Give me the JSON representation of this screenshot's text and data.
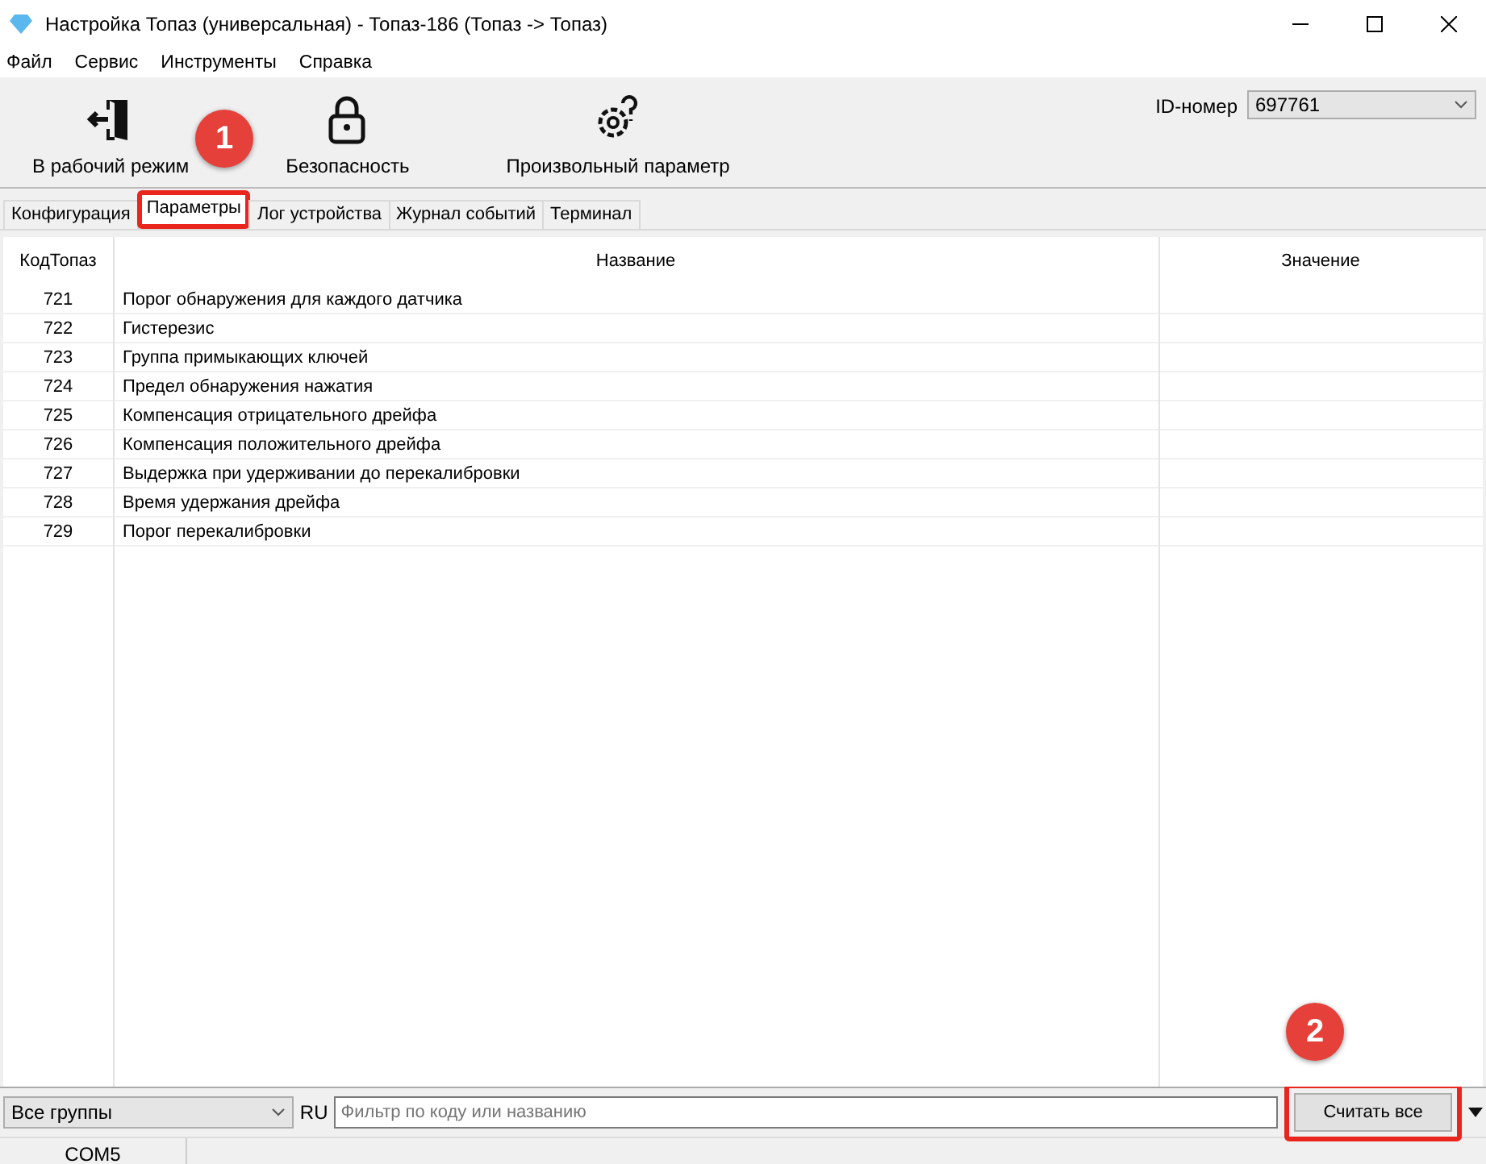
{
  "window": {
    "title": "Настройка Топаз (универсальная) - Топаз-186 (Топаз -> Топаз)"
  },
  "menu": [
    "Файл",
    "Сервис",
    "Инструменты",
    "Справка"
  ],
  "toolbar": {
    "buttons": [
      {
        "kind": "exit",
        "label": "В рабочий режим"
      },
      {
        "kind": "lock",
        "label": "Безопасность"
      },
      {
        "kind": "gear",
        "label": "Произвольный параметр"
      }
    ],
    "id_label": "ID-номер",
    "id_value": "697761"
  },
  "tabs": [
    {
      "label": "Конфигурация",
      "selected": false,
      "highlighted": false
    },
    {
      "label": "Параметры",
      "selected": true,
      "highlighted": true
    },
    {
      "label": "Лог устройства",
      "selected": false,
      "highlighted": false
    },
    {
      "label": "Журнал событий",
      "selected": false,
      "highlighted": false
    },
    {
      "label": "Терминал",
      "selected": false,
      "highlighted": false
    }
  ],
  "table": {
    "columns": [
      "КодТопаз",
      "Название",
      "Значение"
    ],
    "rows": [
      {
        "code": "721",
        "name": "Порог обнаружения для каждого датчика"
      },
      {
        "code": "722",
        "name": "Гистерезис"
      },
      {
        "code": "723",
        "name": "Группа примыкающих ключей"
      },
      {
        "code": "724",
        "name": "Предел обнаружения нажатия"
      },
      {
        "code": "725",
        "name": "Компенсация отрицательного дрейфа"
      },
      {
        "code": "726",
        "name": "Компенсация положительного дрейфа"
      },
      {
        "code": "727",
        "name": "Выдержка при удерживании до перекалибровки"
      },
      {
        "code": "728",
        "name": "Время удержания дрейфа"
      },
      {
        "code": "729",
        "name": "Порог перекалибровки"
      }
    ]
  },
  "bottom": {
    "group": "Все группы",
    "lang": "RU",
    "filter": {
      "placeholder": "Фильтр по коду или названию"
    },
    "read_button": {
      "label": "Считать все",
      "highlighted": true
    }
  },
  "status_bar": {
    "port": "COM5"
  },
  "callouts": [
    {
      "number": "1"
    },
    {
      "number": "2"
    }
  ]
}
